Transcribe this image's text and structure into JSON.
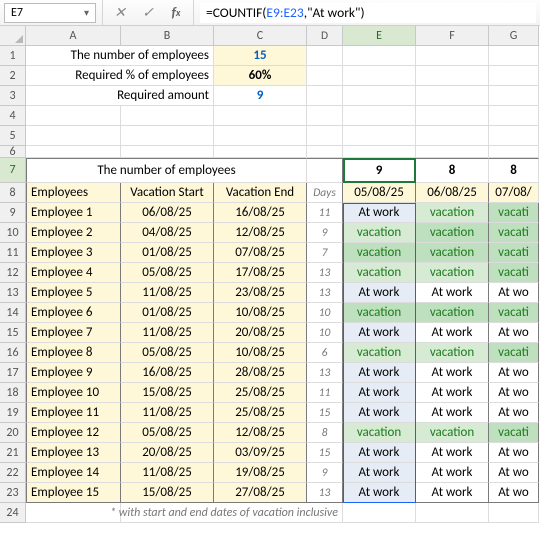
{
  "active_cell": "E7",
  "formula": {
    "prefix": "=COUNTIF(",
    "ref": "E9:E23",
    "suffix": ",\"At work\")"
  },
  "col_letters": [
    "A",
    "B",
    "C",
    "D",
    "E",
    "F",
    "G"
  ],
  "row_nums": [
    "1",
    "2",
    "3",
    "4",
    "5",
    "6",
    "7",
    "8",
    "9",
    "10",
    "11",
    "12",
    "13",
    "14",
    "15",
    "16",
    "17",
    "18",
    "19",
    "20",
    "21",
    "22",
    "23",
    "24"
  ],
  "labels": {
    "num_emp": "The number of employees",
    "req_pct": "Required % of employees",
    "req_amt": "Required amount",
    "emp_hdr": "Employees",
    "vac_start": "Vacation Start",
    "vac_end": "Vacation End",
    "days": "Days",
    "footer": "* with start and end dates of vacation inclusive"
  },
  "vals": {
    "num_emp": "15",
    "req_pct": "60%",
    "req_amt": "9"
  },
  "day_counts": {
    "e": "9",
    "f": "8",
    "g": "8"
  },
  "day_dates": {
    "e": "05/08/25",
    "f": "06/08/25",
    "g": "07/08/"
  },
  "employees": [
    {
      "n": "Employee 1",
      "s": "06/08/25",
      "e": "16/08/25",
      "d": "11",
      "v": [
        "At work",
        "vacation",
        "vacati"
      ],
      "st": [
        "b",
        "g1",
        "g2"
      ]
    },
    {
      "n": "Employee 2",
      "s": "04/08/25",
      "e": "12/08/25",
      "d": "9",
      "v": [
        "vacation",
        "vacation",
        "vacati"
      ],
      "st": [
        "g1",
        "g2",
        "g2"
      ]
    },
    {
      "n": "Employee 3",
      "s": "01/08/25",
      "e": "07/08/25",
      "d": "7",
      "v": [
        "vacation",
        "vacation",
        "vacati"
      ],
      "st": [
        "g2",
        "g2",
        "g2"
      ]
    },
    {
      "n": "Employee 4",
      "s": "05/08/25",
      "e": "17/08/25",
      "d": "13",
      "v": [
        "vacation",
        "vacation",
        "vacati"
      ],
      "st": [
        "g1",
        "g1",
        "g2"
      ]
    },
    {
      "n": "Employee 5",
      "s": "11/08/25",
      "e": "23/08/25",
      "d": "13",
      "v": [
        "At work",
        "At work",
        "At wo"
      ],
      "st": [
        "b",
        "w",
        "w"
      ]
    },
    {
      "n": "Employee 6",
      "s": "01/08/25",
      "e": "10/08/25",
      "d": "10",
      "v": [
        "vacation",
        "vacation",
        "vacati"
      ],
      "st": [
        "g2",
        "g2",
        "g2"
      ]
    },
    {
      "n": "Employee 7",
      "s": "11/08/25",
      "e": "20/08/25",
      "d": "10",
      "v": [
        "At work",
        "At work",
        "At wo"
      ],
      "st": [
        "b",
        "w",
        "w"
      ]
    },
    {
      "n": "Employee 8",
      "s": "05/08/25",
      "e": "10/08/25",
      "d": "6",
      "v": [
        "vacation",
        "vacation",
        "vacati"
      ],
      "st": [
        "g1",
        "g1",
        "g2"
      ]
    },
    {
      "n": "Employee 9",
      "s": "16/08/25",
      "e": "28/08/25",
      "d": "13",
      "v": [
        "At work",
        "At work",
        "At wo"
      ],
      "st": [
        "b",
        "w",
        "w"
      ]
    },
    {
      "n": "Employee 10",
      "s": "15/08/25",
      "e": "25/08/25",
      "d": "11",
      "v": [
        "At work",
        "At work",
        "At wo"
      ],
      "st": [
        "b",
        "w",
        "w"
      ]
    },
    {
      "n": "Employee 11",
      "s": "11/08/25",
      "e": "25/08/25",
      "d": "15",
      "v": [
        "At work",
        "At work",
        "At wo"
      ],
      "st": [
        "b",
        "w",
        "w"
      ]
    },
    {
      "n": "Employee 12",
      "s": "05/08/25",
      "e": "12/08/25",
      "d": "8",
      "v": [
        "vacation",
        "vacation",
        "vacati"
      ],
      "st": [
        "g1",
        "g1",
        "g2"
      ]
    },
    {
      "n": "Employee 13",
      "s": "20/08/25",
      "e": "03/09/25",
      "d": "15",
      "v": [
        "At work",
        "At work",
        "At wo"
      ],
      "st": [
        "b",
        "w",
        "w"
      ]
    },
    {
      "n": "Employee 14",
      "s": "11/08/25",
      "e": "19/08/25",
      "d": "9",
      "v": [
        "At work",
        "At work",
        "At wo"
      ],
      "st": [
        "b",
        "w",
        "w"
      ]
    },
    {
      "n": "Employee 15",
      "s": "15/08/25",
      "e": "27/08/25",
      "d": "13",
      "v": [
        "At work",
        "At work",
        "At wo"
      ],
      "st": [
        "b",
        "w",
        "w"
      ]
    }
  ]
}
